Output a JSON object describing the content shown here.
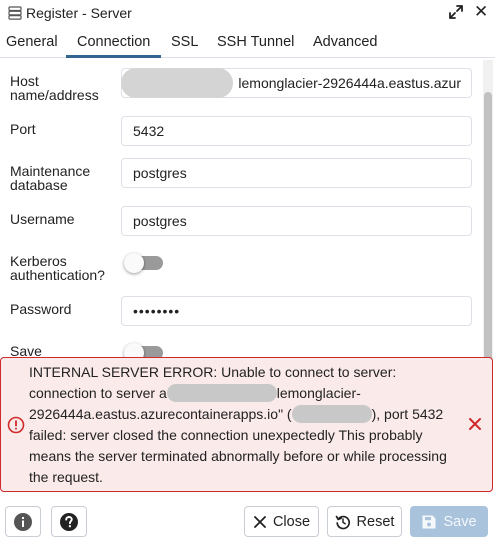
{
  "window": {
    "title": "Register - Server",
    "icon": "server-icon"
  },
  "tabs": [
    {
      "label": "General"
    },
    {
      "label": "Connection"
    },
    {
      "label": "SSL"
    },
    {
      "label": "SSH Tunnel"
    },
    {
      "label": "Advanced"
    }
  ],
  "active_tab": "Connection",
  "form": {
    "host": {
      "label": "Host name/address",
      "value": "lemonglacier-2926444a.eastus.azur"
    },
    "port": {
      "label": "Port",
      "value": "5432"
    },
    "maintenance_db": {
      "label": "Maintenance database",
      "value": "postgres"
    },
    "username": {
      "label": "Username",
      "value": "postgres"
    },
    "kerberos": {
      "label": "Kerberos authentication?",
      "enabled": false
    },
    "password": {
      "label": "Password",
      "value": "••••••••"
    },
    "save_password": {
      "label": "Save",
      "enabled": false
    }
  },
  "error": {
    "part1": "INTERNAL SERVER ERROR: Unable to connect to server: connection to server a",
    "part2": "lemonglacier-2926444a.eastus.azurecontainerapps.io\" (",
    "part3": "), port 5432 failed: server closed the connection unexpectedly This probably means the server terminated abnormally before or while processing the request.",
    "color": "#cf2a2a"
  },
  "footer": {
    "info_icon": "info-icon",
    "help_icon": "help-icon",
    "close_label": "Close",
    "reset_label": "Reset",
    "save_label": "Save"
  },
  "colors": {
    "accent": "#326690",
    "save_disabled": "#a9c3dc",
    "error_bg": "#fbeaea"
  }
}
